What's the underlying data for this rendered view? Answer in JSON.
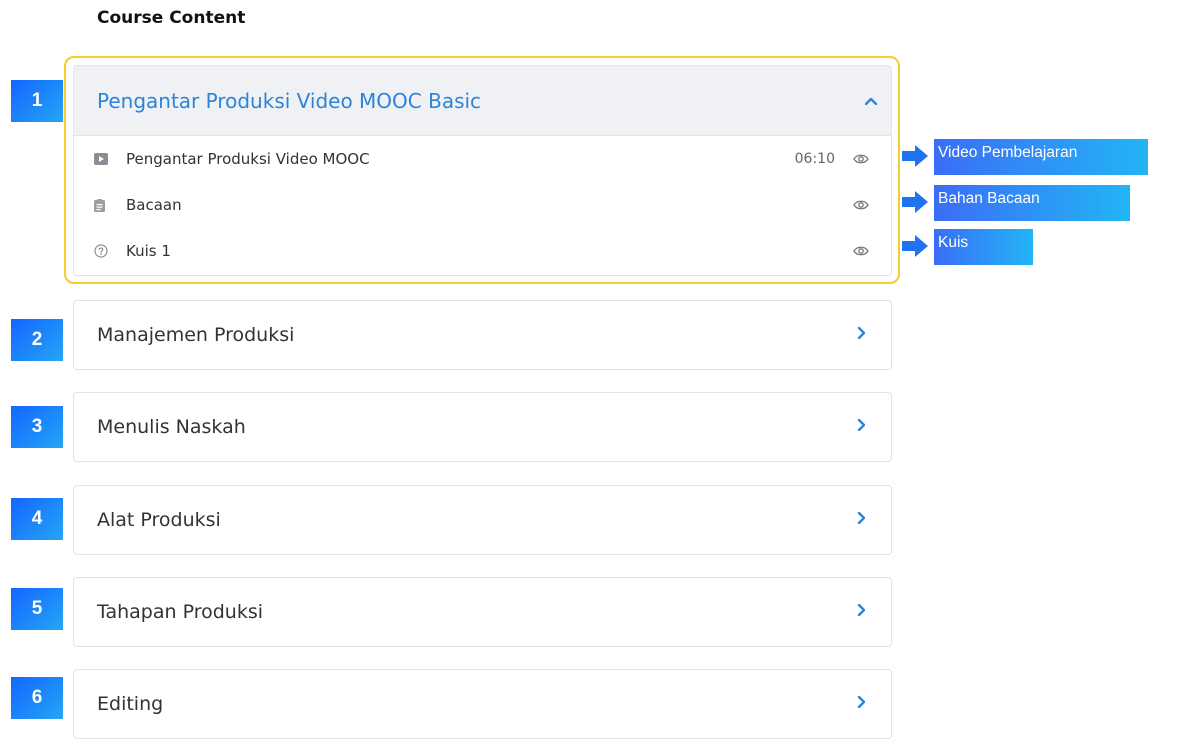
{
  "page": {
    "title": "Course Content"
  },
  "sections": [
    {
      "number": "1",
      "title": "Pengantar Produksi Video MOOC Basic",
      "expanded": true,
      "lessons": [
        {
          "type": "video",
          "icon": "video-play-icon",
          "title": "Pengantar Produksi Video MOOC",
          "duration": "06:10"
        },
        {
          "type": "reading",
          "icon": "document-icon",
          "title": "Bacaan",
          "duration": ""
        },
        {
          "type": "quiz",
          "icon": "question-circle-icon",
          "title": "Kuis 1",
          "duration": ""
        }
      ]
    },
    {
      "number": "2",
      "title": "Manajemen Produksi",
      "expanded": false
    },
    {
      "number": "3",
      "title": "Menulis Naskah",
      "expanded": false
    },
    {
      "number": "4",
      "title": "Alat Produksi",
      "expanded": false
    },
    {
      "number": "5",
      "title": "Tahapan Produksi",
      "expanded": false
    },
    {
      "number": "6",
      "title": "Editing",
      "expanded": false
    }
  ],
  "callouts": [
    {
      "label": "Video Pembelajaran"
    },
    {
      "label": "Bahan Bacaan"
    },
    {
      "label": "Kuis"
    }
  ],
  "colors": {
    "accent": "#2c84d8",
    "highlight_border": "#f5cd2e",
    "badge_gradient_start": "#1565ff",
    "badge_gradient_end": "#23a6f5"
  }
}
